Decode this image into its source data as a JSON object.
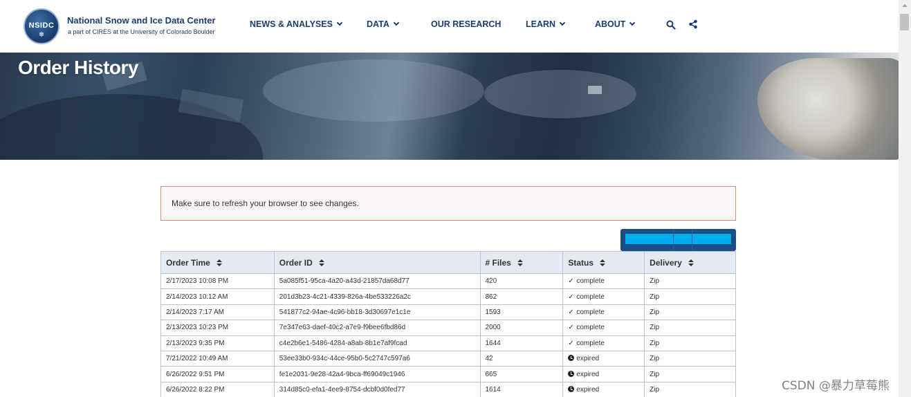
{
  "header": {
    "logo_text": "NSIDC",
    "org_name": "National Snow and Ice Data Center",
    "org_sub": "a part of CIRES at the University of Colorado Boulder"
  },
  "nav": [
    {
      "label": "NEWS & ANALYSES",
      "has_dropdown": true
    },
    {
      "label": "DATA",
      "has_dropdown": true
    },
    {
      "label": "OUR RESEARCH",
      "has_dropdown": false
    },
    {
      "label": "LEARN",
      "has_dropdown": true
    },
    {
      "label": "ABOUT",
      "has_dropdown": true
    }
  ],
  "page": {
    "title": "Order History"
  },
  "alert": {
    "message": "Make sure to refresh your browser to see changes."
  },
  "table": {
    "columns": [
      "Order Time",
      "Order ID",
      "# Files",
      "Status",
      "Delivery"
    ],
    "rows": [
      {
        "time": "2/17/2023 10:08 PM",
        "id": "5a085f51-95ca-4a20-a43d-21857da68d77",
        "files": "420",
        "status": "complete",
        "delivery": "Zip"
      },
      {
        "time": "2/14/2023 10:12 AM",
        "id": "201d3b23-4c21-4339-826a-4be533226a2c",
        "files": "862",
        "status": "complete",
        "delivery": "Zip"
      },
      {
        "time": "2/14/2023 7:17 AM",
        "id": "541877c2-94ae-4c96-bb18-3d30697e1c1e",
        "files": "1593",
        "status": "complete",
        "delivery": "Zip"
      },
      {
        "time": "2/13/2023 10:23 PM",
        "id": "7e347e63-daef-40c2-a7e9-f9bee6fbd86d",
        "files": "2000",
        "status": "complete",
        "delivery": "Zip"
      },
      {
        "time": "2/13/2023 9:35 PM",
        "id": "c4e2b6e1-5486-4284-a8ab-8b1e7af9fcad",
        "files": "1644",
        "status": "complete",
        "delivery": "Zip"
      },
      {
        "time": "7/21/2022 10:49 AM",
        "id": "53ee33b0-934c-44ce-95b0-5c2747c597a6",
        "files": "42",
        "status": "expired",
        "delivery": "Zip"
      },
      {
        "time": "6/26/2022 9:51 PM",
        "id": "fe1e2031-9e28-42a4-9bca-ff69049c1946",
        "files": "665",
        "status": "expired",
        "delivery": "Zip"
      },
      {
        "time": "6/26/2022 8:22 PM",
        "id": "314d85c0-efa1-4ee9-8754-dcbf0d0fed77",
        "files": "1614",
        "status": "expired",
        "delivery": "Zip"
      }
    ]
  },
  "watermark": "CSDN @暴力草莓熊"
}
